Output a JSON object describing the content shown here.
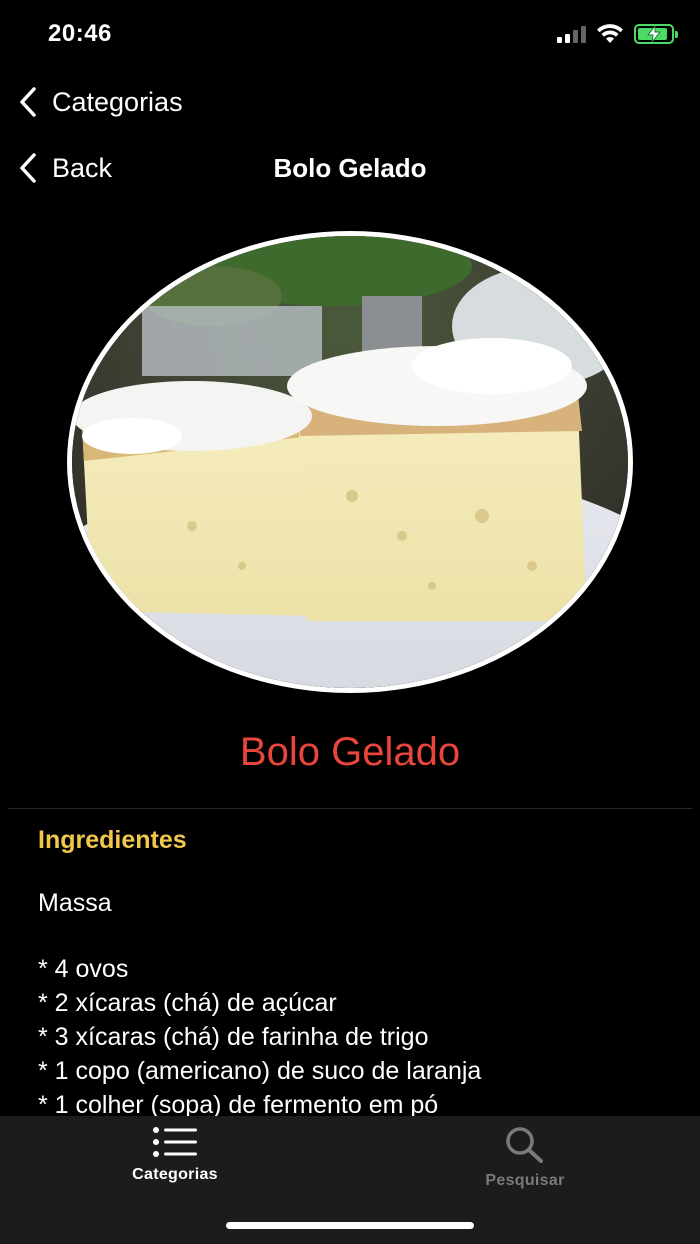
{
  "status_bar": {
    "time": "20:46",
    "signal_icon": "cellular-signal-icon",
    "wifi_icon": "wifi-icon",
    "battery_icon": "battery-charging-icon",
    "battery_level": 0.9,
    "battery_color": "#4cd964"
  },
  "nav": {
    "categories_back_label": "Categorias",
    "back_label": "Back",
    "title": "Bolo Gelado"
  },
  "recipe": {
    "image_icon": "recipe-photo",
    "title": "Bolo Gelado",
    "title_color": "#e8453c",
    "section_title": "Ingredientes",
    "section_color": "#f2c84b",
    "subsection": "Massa",
    "ingredients": [
      "* 4 ovos",
      "* 2 xícaras (chá) de açúcar",
      "* 3 xícaras (chá) de farinha de trigo",
      "* 1 copo (americano) de suco de laranja",
      "* 1 colher (sopa) de fermento em pó"
    ]
  },
  "tab_bar": {
    "tabs": [
      {
        "label": "Categorias",
        "icon": "list-icon",
        "active": true
      },
      {
        "label": "Pesquisar",
        "icon": "search-icon",
        "active": false
      }
    ]
  }
}
